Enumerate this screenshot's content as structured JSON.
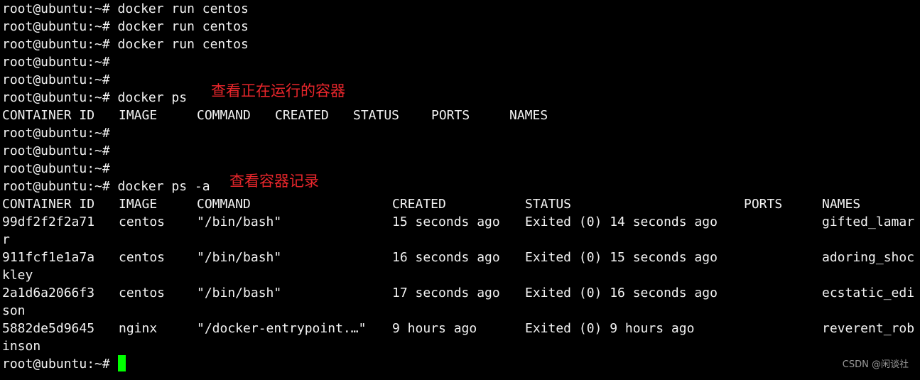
{
  "lines": {
    "l0": "root@ubuntu:~# docker run centos",
    "l1": "root@ubuntu:~# docker run centos",
    "l2": "root@ubuntu:~# docker run centos",
    "l3": "root@ubuntu:~#",
    "l4": "root@ubuntu:~#",
    "l5": "root@ubuntu:~# docker ps",
    "l7": "root@ubuntu:~#",
    "l8": "root@ubuntu:~#",
    "l9": "root@ubuntu:~#",
    "l10": "root@ubuntu:~# docker ps -a",
    "l20": "root@ubuntu:~# "
  },
  "ps_header": {
    "container_id": "CONTAINER ID",
    "image": "IMAGE",
    "command": "COMMAND",
    "created": "CREATED",
    "status": "STATUS",
    "ports": "PORTS",
    "names": "NAMES"
  },
  "psa_header": {
    "container_id": "CONTAINER ID",
    "image": "IMAGE",
    "command": "COMMAND",
    "created": "CREATED",
    "status": "STATUS",
    "ports": "PORTS",
    "names": "NAMES"
  },
  "containers": [
    {
      "id": "99df2f2f2a71",
      "image": "centos",
      "command": "\"/bin/bash\"",
      "created": "15 seconds ago",
      "status": "Exited (0) 14 seconds ago",
      "ports": "",
      "name_part1": "gifted_lamar",
      "name_part2": "r"
    },
    {
      "id": "911fcf1e1a7a",
      "image": "centos",
      "command": "\"/bin/bash\"",
      "created": "16 seconds ago",
      "status": "Exited (0) 15 seconds ago",
      "ports": "",
      "name_part1": "adoring_shoc",
      "name_part2": "kley"
    },
    {
      "id": "2a1d6a2066f3",
      "image": "centos",
      "command": "\"/bin/bash\"",
      "created": "17 seconds ago",
      "status": "Exited (0) 16 seconds ago",
      "ports": "",
      "name_part1": "ecstatic_edi",
      "name_part2": "son"
    },
    {
      "id": "5882de5d9645",
      "image": "nginx",
      "command": "\"/docker-entrypoint.…\"",
      "created": "9 hours ago",
      "status": "Exited (0) 9 hours ago",
      "ports": "",
      "name_part1": "reverent_rob",
      "name_part2": "inson"
    }
  ],
  "annotations": {
    "ps": "查看正在运行的容器",
    "psa": "查看容器记录"
  },
  "watermark": "CSDN @闲谈社",
  "colors": {
    "background": "#000000",
    "text": "#f2f2f2",
    "annotation": "#e8262b",
    "cursor": "#00ff00"
  }
}
